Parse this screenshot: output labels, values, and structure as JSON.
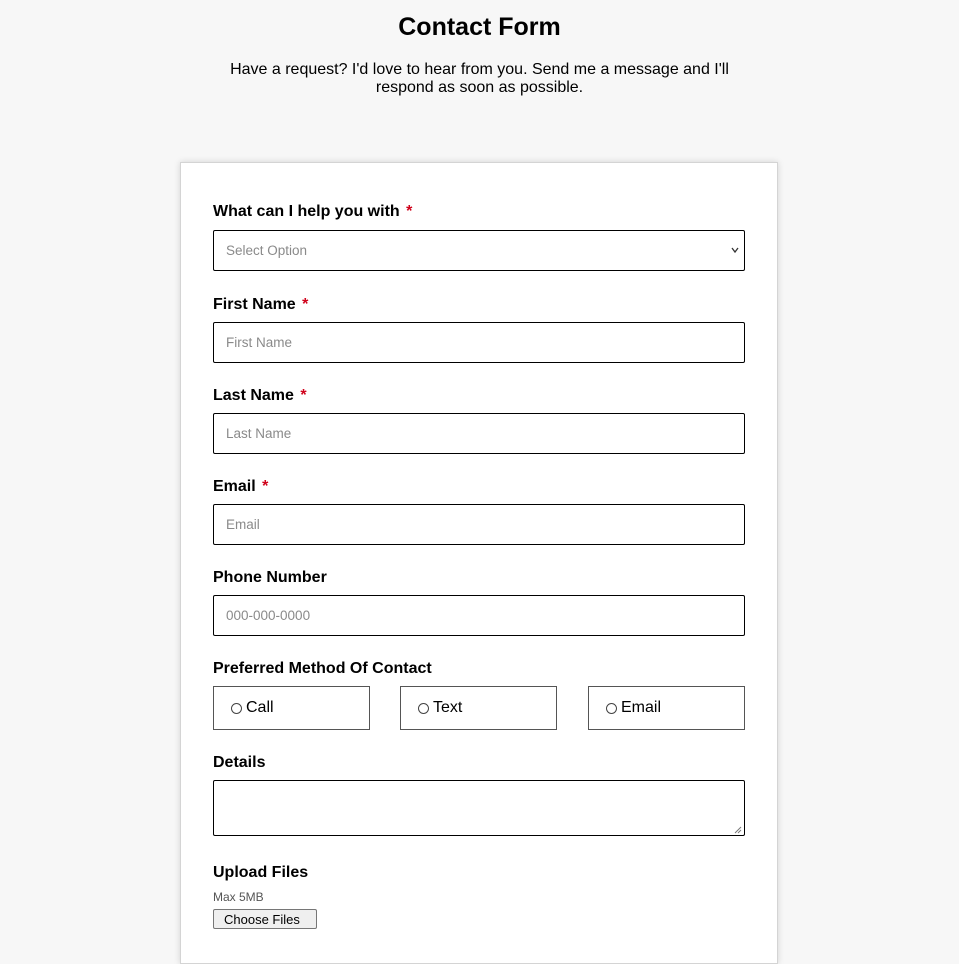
{
  "header": {
    "title": "Contact Form",
    "subtitle": "Have a request? I'd love to hear from you. Send me a message and I'll respond as soon as possible."
  },
  "form": {
    "help_with": {
      "label": "What can I help you with",
      "required_mark": "*",
      "placeholder": "Select Option",
      "icon": "chevron-down-icon"
    },
    "first_name": {
      "label": "First Name",
      "required_mark": "*",
      "placeholder": "First Name"
    },
    "last_name": {
      "label": "Last Name",
      "required_mark": "*",
      "placeholder": "Last Name"
    },
    "email": {
      "label": "Email",
      "required_mark": "*",
      "placeholder": "Email"
    },
    "phone": {
      "label": "Phone Number",
      "placeholder": "000-000-0000"
    },
    "contact_method": {
      "label": "Preferred Method Of Contact",
      "options": [
        {
          "label": "Call",
          "selected": false
        },
        {
          "label": "Text",
          "selected": false
        },
        {
          "label": "Email",
          "selected": false
        }
      ]
    },
    "details": {
      "label": "Details",
      "value": ""
    },
    "upload": {
      "label": "Upload Files",
      "note": "Max 5MB",
      "button_label": "Choose Files"
    }
  },
  "colors": {
    "page_background": "#f7f7f7",
    "card_background": "#ffffff",
    "required": "#d0021b",
    "placeholder": "#8a8a8a"
  }
}
